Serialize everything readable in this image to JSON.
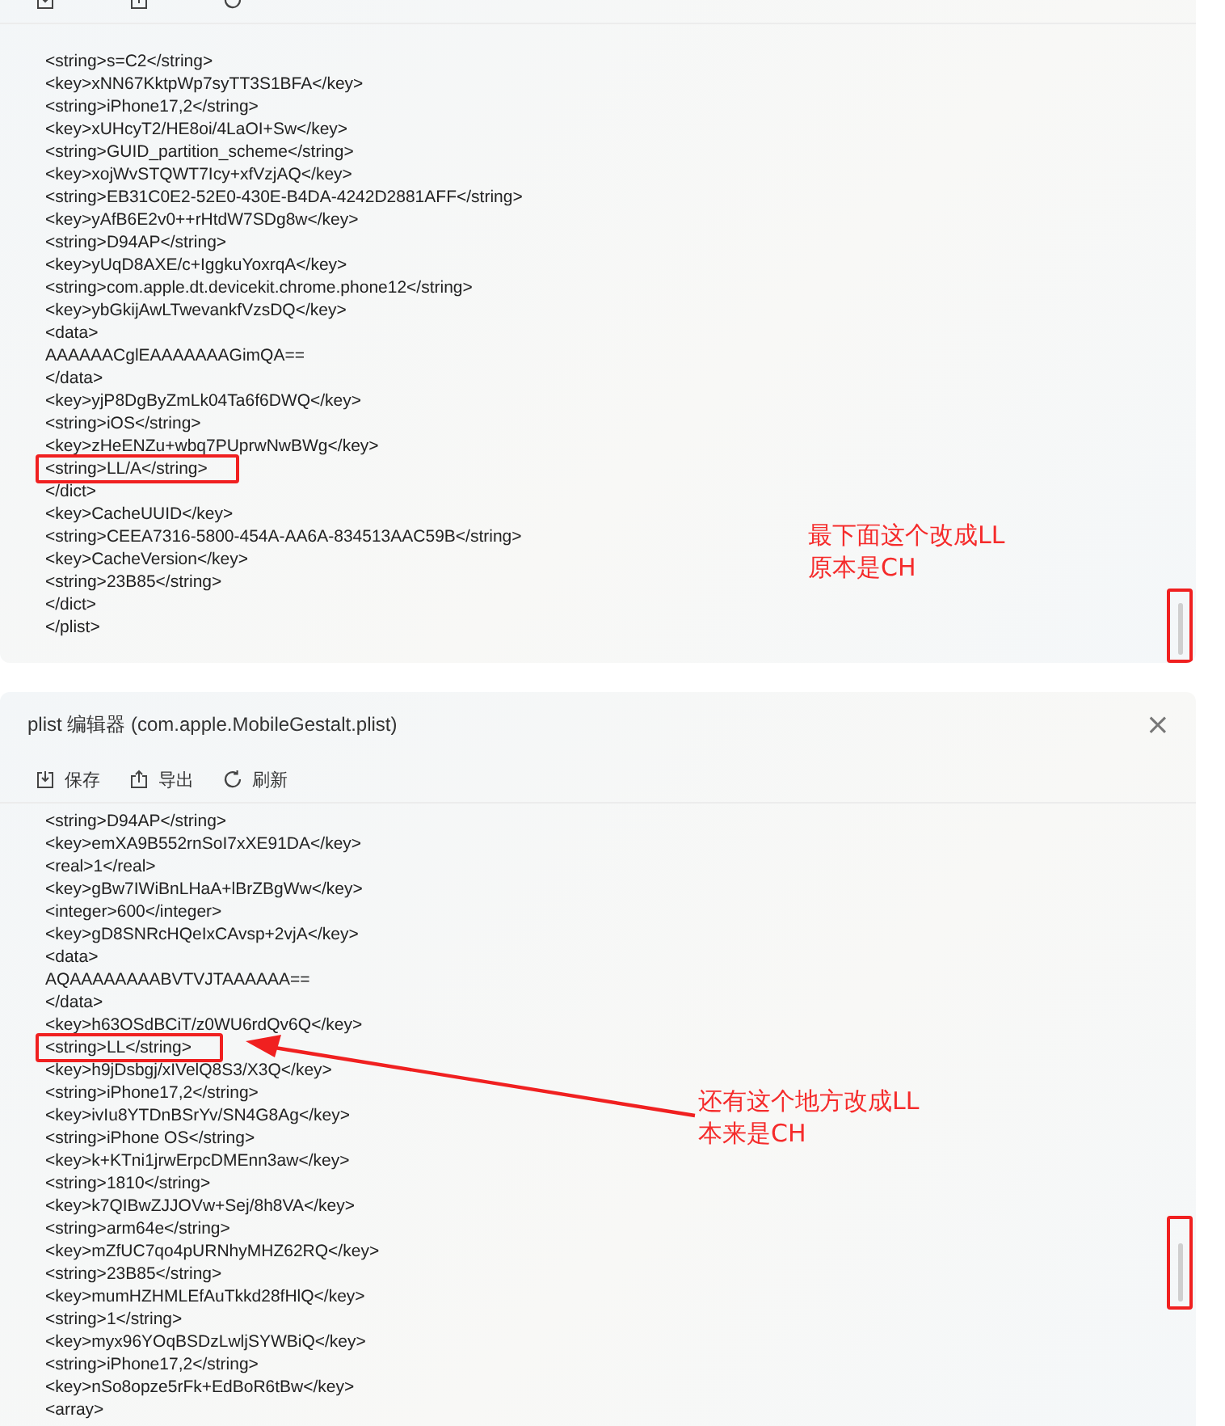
{
  "panels": [
    {
      "kind": "continued",
      "lines": [
        {
          "text": "<string>s=C2</string>",
          "highlighted": false
        },
        {
          "text": "<key>xNN67KktpWp7syTT3S1BFA</key>",
          "highlighted": false
        },
        {
          "text": "<string>iPhone17,2</string>",
          "highlighted": false
        },
        {
          "text": "<key>xUHcyT2/HE8oi/4LaOI+Sw</key>",
          "highlighted": false
        },
        {
          "text": "<string>GUID_partition_scheme</string>",
          "highlighted": false
        },
        {
          "text": "<key>xojWvSTQWT7Icy+xfVzjAQ</key>",
          "highlighted": false
        },
        {
          "text": "<string>EB31C0E2-52E0-430E-B4DA-4242D2881AFF</string>",
          "highlighted": false
        },
        {
          "text": "<key>yAfB6E2v0++rHtdW7SDg8w</key>",
          "highlighted": false
        },
        {
          "text": "<string>D94AP</string>",
          "highlighted": false
        },
        {
          "text": "<key>yUqD8AXE/c+IggkuYoxrqA</key>",
          "highlighted": false
        },
        {
          "text": "<string>com.apple.dt.devicekit.chrome.phone12</string>",
          "highlighted": false
        },
        {
          "text": "<key>ybGkijAwLTwevankfVzsDQ</key>",
          "highlighted": false
        },
        {
          "text": "<data>",
          "highlighted": false
        },
        {
          "text": "AAAAAACglEAAAAAAAGimQA==",
          "highlighted": false
        },
        {
          "text": "</data>",
          "highlighted": false
        },
        {
          "text": "<key>yjP8DgByZmLk04Ta6f6DWQ</key>",
          "highlighted": false
        },
        {
          "text": "<string>iOS</string>",
          "highlighted": false
        },
        {
          "text": "<key>zHeENZu+wbq7PUprwNwBWg</key>",
          "highlighted": false
        },
        {
          "text": "<string>LL/A</string>",
          "highlighted": true
        },
        {
          "text": "</dict>",
          "highlighted": false
        },
        {
          "text": "<key>CacheUUID</key>",
          "highlighted": false
        },
        {
          "text": "<string>CEEA7316-5800-454A-AA6A-834513AAC59B</string>",
          "highlighted": false
        },
        {
          "text": "<key>CacheVersion</key>",
          "highlighted": false
        },
        {
          "text": "<string>23B85</string>",
          "highlighted": false
        },
        {
          "text": "</dict>",
          "highlighted": false
        },
        {
          "text": "</plist>",
          "highlighted": false
        }
      ],
      "note": [
        "最下面这个改成LL",
        "原本是CH"
      ]
    },
    {
      "kind": "window",
      "title": "plist 编辑器 (com.apple.MobileGestalt.plist)",
      "close": "×",
      "toolbar": [
        "保存",
        "导出",
        "刷新"
      ],
      "lines": [
        {
          "text": "<string>D94AP</string>",
          "highlighted": false
        },
        {
          "text": "<key>emXA9B552rnSoI7xXE91DA</key>",
          "highlighted": false
        },
        {
          "text": "<real>1</real>",
          "highlighted": false
        },
        {
          "text": "<key>gBw7IWiBnLHaA+lBrZBgWw</key>",
          "highlighted": false
        },
        {
          "text": "<integer>600</integer>",
          "highlighted": false
        },
        {
          "text": "<key>gD8SNRcHQeIxCAvsp+2vjA</key>",
          "highlighted": false
        },
        {
          "text": "<data>",
          "highlighted": false
        },
        {
          "text": "AQAAAAAAAABVTVJTAAAAAA==",
          "highlighted": false
        },
        {
          "text": "</data>",
          "highlighted": false
        },
        {
          "text": "<key>h63OSdBCiT/z0WU6rdQv6Q</key>",
          "highlighted": false
        },
        {
          "text": "<string>LL</string>",
          "highlighted": true
        },
        {
          "text": "<key>h9jDsbgj/xIVelQ8S3/X3Q</key>",
          "highlighted": false
        },
        {
          "text": "<string>iPhone17,2</string>",
          "highlighted": false
        },
        {
          "text": "<key>ivIu8YTDnBSrYv/SN4G8Ag</key>",
          "highlighted": false
        },
        {
          "text": "<string>iPhone OS</string>",
          "highlighted": false
        },
        {
          "text": "<key>k+KTni1jrwErpcDMEnn3aw</key>",
          "highlighted": false
        },
        {
          "text": "<string>1810</string>",
          "highlighted": false
        },
        {
          "text": "<key>k7QIBwZJJOVw+Sej/8h8VA</key>",
          "highlighted": false
        },
        {
          "text": "<string>arm64e</string>",
          "highlighted": false
        },
        {
          "text": "<key>mZfUC7qo4pURNhyMHZ62RQ</key>",
          "highlighted": false
        },
        {
          "text": "<string>23B85</string>",
          "highlighted": false
        },
        {
          "text": "<key>mumHZHMLEfAuTkkd28fHlQ</key>",
          "highlighted": false
        },
        {
          "text": "<string>1</string>",
          "highlighted": false
        },
        {
          "text": "<key>myx96YOqBSDzLwljSYWBiQ</key>",
          "highlighted": false
        },
        {
          "text": "<string>iPhone17,2</string>",
          "highlighted": false
        },
        {
          "text": "<key>nSo8opze5rFk+EdBoR6tBw</key>",
          "highlighted": false
        },
        {
          "text": "<array>",
          "highlighted": false
        }
      ],
      "note": [
        "还有这个地方改成LL",
        "本来是CH"
      ],
      "arrow": true
    }
  ]
}
